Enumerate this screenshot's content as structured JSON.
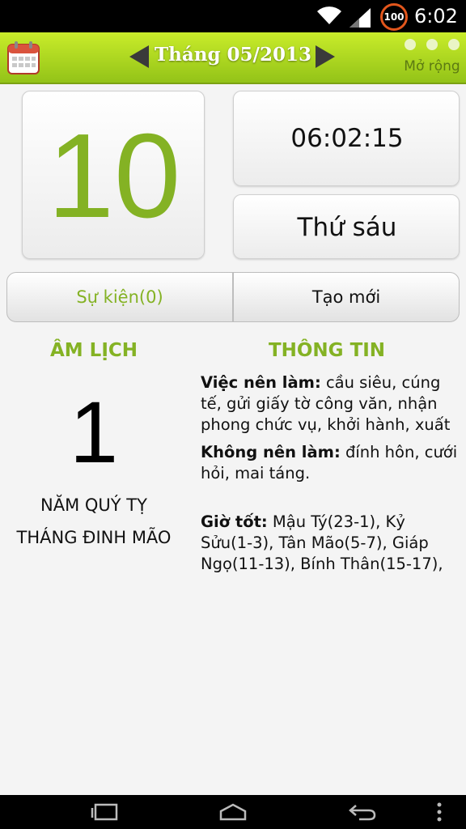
{
  "status_bar": {
    "time": "6:02",
    "battery_level": "100",
    "icons": [
      "wifi-icon",
      "signal-icon",
      "battery-icon"
    ]
  },
  "header": {
    "title": "Tháng 05/2013",
    "more_label": "Mở rộng",
    "icons": [
      "calendar-icon",
      "arrow-left-icon",
      "arrow-right-icon",
      "more-dots-icon"
    ],
    "accent_color": "#9ccc1e"
  },
  "date": {
    "day": "10",
    "time": "06:02:15",
    "weekday": "Thứ sáu"
  },
  "buttons": {
    "events": "Sự kiện(0)",
    "create": "Tạo mới"
  },
  "lunar": {
    "heading": "ÂM LỊCH",
    "day": "1",
    "year": "NĂM QUÝ TỴ",
    "month": "THÁNG ĐINH MÃO"
  },
  "info": {
    "heading": "THÔNG TIN",
    "good_label": "Việc nên làm:",
    "good_text": "cầu siêu, cúng tế, gửi giấy tờ công văn, nhận phong chức vụ, khởi hành, xuất",
    "bad_label": "Không nên làm:",
    "bad_text": "đính hôn, cưới hỏi, mai táng.",
    "hours_label": "Giờ tốt:",
    "hours_text": "Mậu Tý(23-1), Kỷ Sửu(1-3), Tân Mão(5-7), Giáp Ngọ(11-13), Bính Thân(15-17),"
  },
  "nav_bar": {
    "icons": [
      "recents-icon",
      "home-icon",
      "back-icon",
      "menu-icon"
    ]
  },
  "colors": {
    "green_text": "#84b224",
    "background": "#f4f4f4"
  }
}
